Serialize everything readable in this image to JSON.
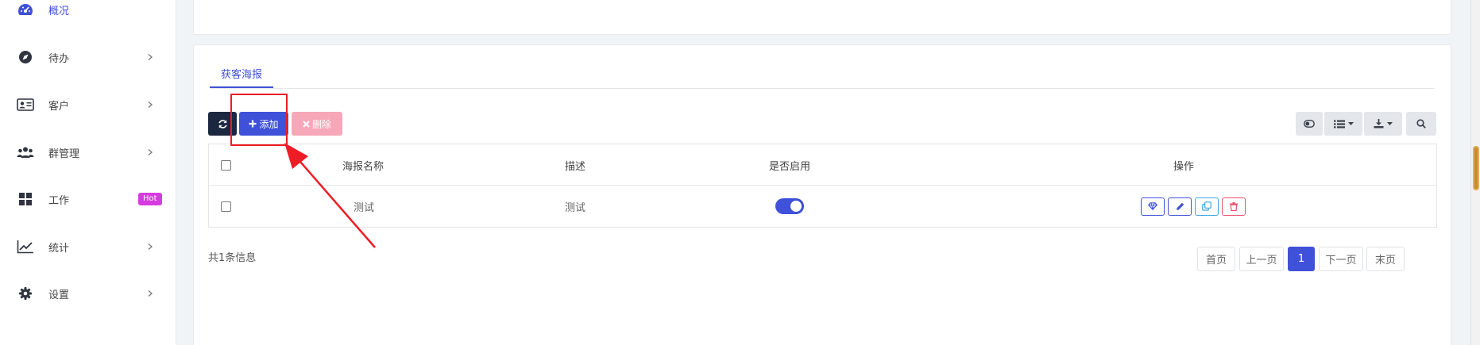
{
  "sidebar": {
    "items": [
      {
        "label": "概况",
        "icon": "dashboard-icon",
        "active": true
      },
      {
        "label": "待办",
        "icon": "compass-icon"
      },
      {
        "label": "客户",
        "icon": "id-card-icon"
      },
      {
        "label": "群管理",
        "icon": "users-icon"
      },
      {
        "label": "工作",
        "icon": "grid-icon",
        "badge": "Hot"
      },
      {
        "label": "统计",
        "icon": "line-chart-icon"
      },
      {
        "label": "设置",
        "icon": "gear-icon"
      }
    ]
  },
  "tabs": [
    {
      "label": "获客海报"
    }
  ],
  "toolbar": {
    "add_label": "添加",
    "delete_label": "删除"
  },
  "table": {
    "columns": [
      "海报名称",
      "描述",
      "是否启用",
      "操作"
    ],
    "rows": [
      {
        "name": "测试",
        "description": "测试",
        "enabled": true
      }
    ]
  },
  "footer": {
    "total_text": "共1条信息"
  },
  "pagination": {
    "first": "首页",
    "prev": "上一页",
    "current": "1",
    "next": "下一页",
    "last": "末页"
  },
  "colors": {
    "primary": "#3f51d8",
    "danger_light": "#f6a7b8",
    "dark": "#1b2840",
    "hot_badge": "#d63be0",
    "annotation": "#ee1c25"
  }
}
